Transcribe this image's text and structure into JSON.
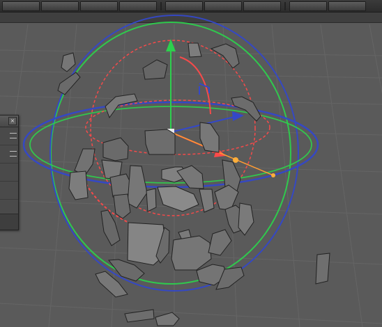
{
  "viewport": {
    "panel_label": "",
    "floating_window_close": "×"
  },
  "colors": {
    "background": "#5a5a5a",
    "grid": "#6b6b6b",
    "blue_gizmo": "#3448c9",
    "green_gizmo": "#2dd04d",
    "red_gizmo": "#ff4a4a",
    "orange_axis": "#ff9c33"
  },
  "icons": {
    "move_y": "green-up-arrow-icon",
    "move_x": "red-arrow-icon",
    "move_z": "blue-arrow-icon"
  }
}
